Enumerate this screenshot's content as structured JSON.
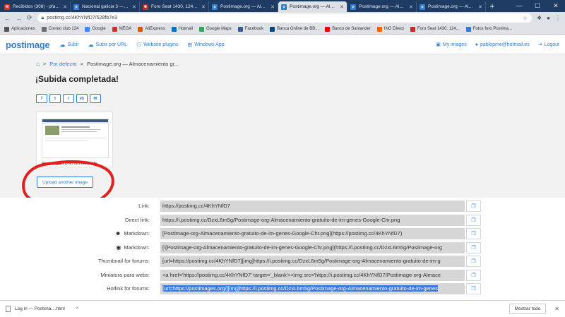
{
  "browser": {
    "tabs": [
      {
        "title": "Recibidos (308) - pfafu...",
        "icon": "gmail-icon",
        "color": "#d93025",
        "glyph": "M",
        "active": false
      },
      {
        "title": "Nacional galicia 3 — Po...",
        "icon": "postimage-icon",
        "color": "#2d7dd2",
        "glyph": "p",
        "active": false
      },
      {
        "title": "Foro Seat 1430, 124, 124...",
        "icon": "seat-icon",
        "color": "#c62828",
        "glyph": "✱",
        "active": false
      },
      {
        "title": "Postimage.org — Almac...",
        "icon": "postimage-icon",
        "color": "#2d7dd2",
        "glyph": "p",
        "active": false
      },
      {
        "title": "Postimage.org — Alma...",
        "icon": "postimage-icon",
        "color": "#2d7dd2",
        "glyph": "p",
        "active": true
      },
      {
        "title": "Postimage.org — Almac...",
        "icon": "postimage-icon",
        "color": "#2d7dd2",
        "glyph": "p",
        "active": false
      },
      {
        "title": "Postimage.org — Almac...",
        "icon": "postimage-icon",
        "color": "#2d7dd2",
        "glyph": "p",
        "active": false
      }
    ],
    "url": "postimg.cc/4KhYNfD7/528fb7e3",
    "bookmarks": [
      {
        "label": "Aplicaciones",
        "color": "#555"
      },
      {
        "label": "Correo club 124",
        "color": "#6d6d6d"
      },
      {
        "label": "Google",
        "color": "#4285f4"
      },
      {
        "label": "MEGA",
        "color": "#d32f2f"
      },
      {
        "label": "AliExpress",
        "color": "#e65100"
      },
      {
        "label": "Hotmail",
        "color": "#0072c6"
      },
      {
        "label": "Google Maps",
        "color": "#34a853"
      },
      {
        "label": "Facebook",
        "color": "#3b5998"
      },
      {
        "label": "Banca Online de BB...",
        "color": "#004481"
      },
      {
        "label": "Banco de Santander",
        "color": "#ec0000"
      },
      {
        "label": "ING Direct",
        "color": "#ff6200"
      },
      {
        "label": "Foro Seat 1430, 124...",
        "color": "#c62828"
      },
      {
        "label": "Fotos foro Postima...",
        "color": "#2d7dd2"
      }
    ]
  },
  "site": {
    "logo": "postimage",
    "nav": [
      {
        "label": "Subir",
        "icon": "upload-cloud-icon"
      },
      {
        "label": "Subir por URL",
        "icon": "upload-url-icon"
      },
      {
        "label": "Website plugins",
        "icon": "plugins-icon"
      },
      {
        "label": "Windows App",
        "icon": "windows-icon"
      }
    ],
    "my_images": "My images",
    "user": "pablopme@hotmail.es",
    "logout": "Logout"
  },
  "content": {
    "breadcrumb_default": "Por defecto",
    "breadcrumb_title": "Postimage.org — Almacenamiento gr...",
    "heading": "¡Subida completada!",
    "shares": [
      {
        "label": "f",
        "icon": "facebook-icon"
      },
      {
        "label": "t",
        "icon": "twitter-icon"
      },
      {
        "label": "r",
        "icon": "reddit-icon"
      },
      {
        "label": "vk",
        "icon": "vk-icon"
      },
      {
        "label": "✉",
        "icon": "email-icon"
      }
    ],
    "thumb_name": "Postimage-org-Almacenamiento",
    "upload_another": "Upload another image"
  },
  "links": [
    {
      "label": "Link:",
      "value": "https://postimg.cc/4KhYNfD7",
      "icon": "",
      "selected": false
    },
    {
      "label": "Direct link:",
      "value": "https://i.postimg.cc/DzxL6m5g/Postimage-org-Almacenamiento-gratuito-de-im-genes-Google-Chr.png",
      "icon": "",
      "selected": false
    },
    {
      "label": "Markdown:",
      "value": "[Postimage-org-Almacenamiento-gratuito-de-im-genes-Google-Chr.png](https://postimg.cc/4KhYNfD7)",
      "icon": "reddit-icon",
      "selected": false
    },
    {
      "label": "Markdown:",
      "value": "[![Postimage-org-Almacenamiento-gratuito-de-im-genes-Google-Chr.png](https://i.postimg.cc/DzxL6m5g/Postimage-org",
      "icon": "github-icon",
      "selected": false
    },
    {
      "label": "Thumbnail for forums:",
      "value": "[url=https://postimg.cc/4KhYNfD7][img]https://i.postimg.cc/DzxL6m5g/Postimage-org-Almacenamiento-gratuito-de-im-g",
      "icon": "",
      "selected": false
    },
    {
      "label": "Miniatura para webs:",
      "value": "<a href='https://postimg.cc/4KhYNfD7' target='_blank'><img src='https://i.postimg.cc/4KhYNfD7/Postimage-org-Almace",
      "icon": "",
      "selected": false
    },
    {
      "label": "Hotlink for forums:",
      "value": "[url=https://postimages.org/][img]https://i.postimg.cc/DzxL6m5g/Postimage-org-Almacenamiento-gratuito-de-im-genes",
      "icon": "",
      "selected": true
    }
  ],
  "download": {
    "filename": "Log in — Postima....html",
    "show_all": "Mostrar todo"
  },
  "colors": {
    "accent": "#2d7dd2",
    "annotation": "#e0201f",
    "selection": "#3b7ae0"
  }
}
